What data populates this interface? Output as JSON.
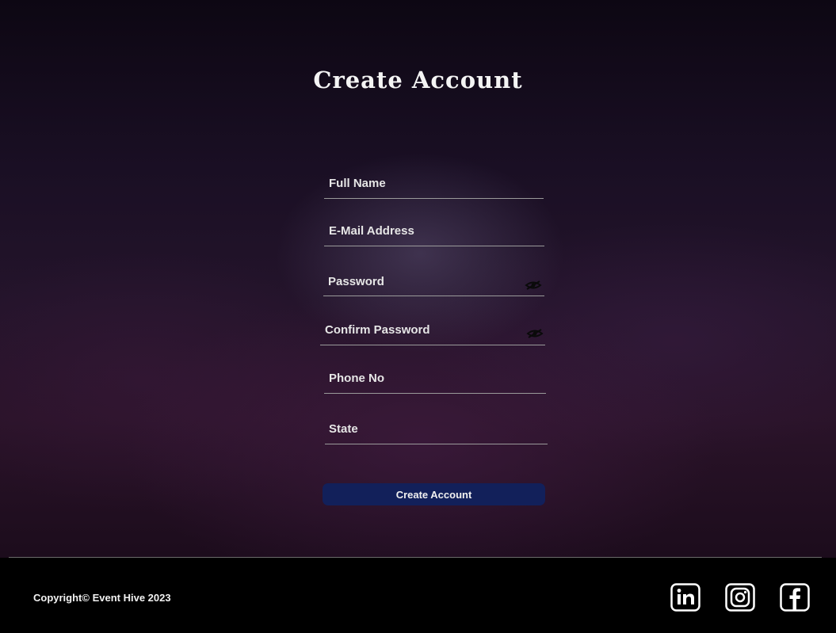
{
  "page": {
    "title": "Create Account"
  },
  "form": {
    "fields": [
      {
        "label": "Full Name"
      },
      {
        "label": "E-Mail Address"
      },
      {
        "label": "Password",
        "icon": "eye-slash-icon"
      },
      {
        "label": "Confirm Password",
        "icon": "eye-slash-icon"
      },
      {
        "label": "Phone No"
      },
      {
        "label": "State"
      }
    ],
    "submit_label": "Create Account"
  },
  "footer": {
    "copyright": "Copyright© Event Hive 2023",
    "social": [
      {
        "icon": "linkedin-icon"
      },
      {
        "icon": "instagram-icon"
      },
      {
        "icon": "facebook-icon"
      }
    ]
  },
  "colors": {
    "accent_button": "#12205a",
    "background": "#000000",
    "text": "#ffffff"
  }
}
